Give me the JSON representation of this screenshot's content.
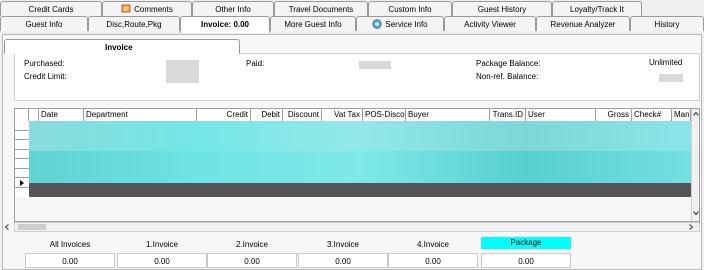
{
  "tabs_row1": [
    "Credit Cards",
    "Comments",
    "Other Info",
    "Travel Documents",
    "Custom Info",
    "Guest History",
    "Loyalty/Track It"
  ],
  "tabs_row2": [
    "Guest Info",
    "Disc,Route,Pkg",
    "Invoice: 0.00",
    "More Guest Info",
    "Service Info",
    "Activity Viewer",
    "Revenue Analyzer",
    "History"
  ],
  "subtab": {
    "label": "Invoice"
  },
  "info": {
    "purchased_label": "Purchased:",
    "credit_limit_label": "Credit Limit:",
    "paid_label": "Paid:",
    "package_balance_label": "Package Balance:",
    "package_balance_value": "Unlimited",
    "nonref_balance_label": "Non-ref. Balance:"
  },
  "grid": {
    "columns": [
      "Date",
      "Department",
      "Credit",
      "Debit",
      "Discount",
      "Vat Tax",
      "POS-Discou",
      "Buyer",
      "Trans.ID",
      "User",
      "Gross",
      "Check#",
      "Manua"
    ]
  },
  "summary": {
    "labels": [
      "All Invoices",
      "1.Invoice",
      "2.Invoice",
      "3.Invoice",
      "4.Invoice",
      "Package"
    ],
    "values": [
      "0.00",
      "0.00",
      "0.00",
      "0.00",
      "0.00",
      "0.00"
    ],
    "highlight_color": "#00ffff"
  },
  "icons": {
    "comments": "comments-icon",
    "service": "service-info-icon",
    "scroll_up": "scroll-up-arrow",
    "scroll_down": "scroll-down-arrow",
    "scroll_left": "scroll-left-arrow",
    "scroll_right": "scroll-right-arrow",
    "row_pointer": "row-pointer-icon"
  }
}
